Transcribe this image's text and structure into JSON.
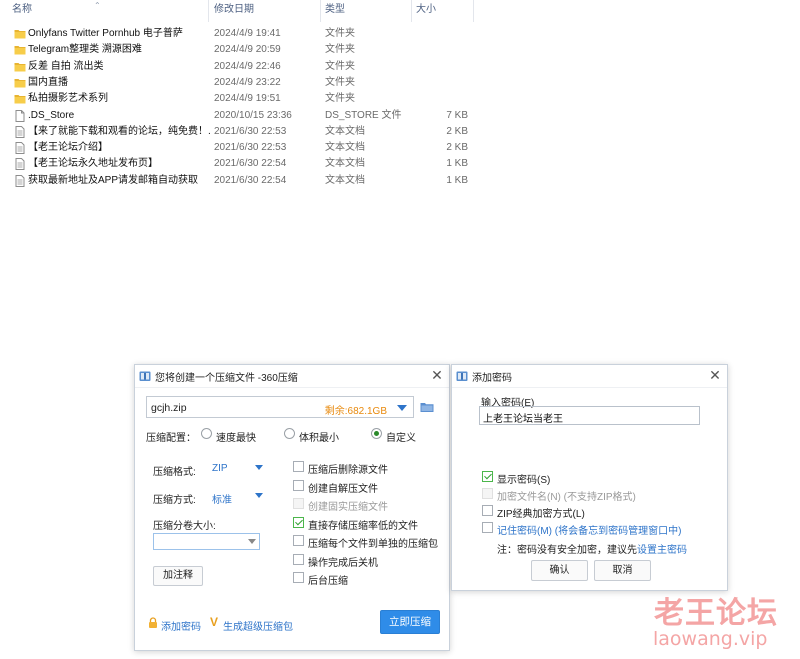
{
  "file_list": {
    "columns": {
      "name": "名称",
      "date": "修改日期",
      "type": "类型",
      "size": "大小"
    },
    "rows": [
      {
        "icon": "folder-icon",
        "name": "Onlyfans Twitter Pornhub 电子普萨",
        "date": "2024/4/9 19:41",
        "type": "文件夹",
        "size": ""
      },
      {
        "icon": "folder-icon",
        "name": "Telegram整理类 溯源困难",
        "date": "2024/4/9 20:59",
        "type": "文件夹",
        "size": ""
      },
      {
        "icon": "folder-icon",
        "name": "反差 自拍 流出类",
        "date": "2024/4/9 22:46",
        "type": "文件夹",
        "size": ""
      },
      {
        "icon": "folder-icon",
        "name": "国内直播",
        "date": "2024/4/9 23:22",
        "type": "文件夹",
        "size": ""
      },
      {
        "icon": "folder-icon",
        "name": "私拍摄影艺术系列",
        "date": "2024/4/9 19:51",
        "type": "文件夹",
        "size": ""
      },
      {
        "icon": "file-icon",
        "name": ".DS_Store",
        "date": "2020/10/15 23:36",
        "type": "DS_STORE 文件",
        "size": "7 KB"
      },
      {
        "icon": "text-file-icon",
        "name": "【来了就能下载和观看的论坛，纯免费！...",
        "date": "2021/6/30 22:53",
        "type": "文本文档",
        "size": "2 KB"
      },
      {
        "icon": "text-file-icon",
        "name": "【老王论坛介绍】",
        "date": "2021/6/30 22:53",
        "type": "文本文档",
        "size": "2 KB"
      },
      {
        "icon": "text-file-icon",
        "name": "【老王论坛永久地址发布页】",
        "date": "2021/6/30 22:54",
        "type": "文本文档",
        "size": "1 KB"
      },
      {
        "icon": "text-file-icon",
        "name": "获取最新地址及APP请发邮箱自动获取",
        "date": "2021/6/30 22:54",
        "type": "文本文档",
        "size": "1 KB"
      }
    ]
  },
  "compress_dialog": {
    "title": "您将创建一个压缩文件 -360压缩",
    "filename": "gcjh.zip",
    "free_space": "剩余:682.1GB",
    "config_label": "压缩配置：",
    "radio_fast": "速度最快",
    "radio_small": "体积最小",
    "radio_custom": "自定义",
    "format_label": "压缩格式:",
    "format_value": "ZIP",
    "method_label": "压缩方式:",
    "method_value": "标准",
    "split_label": "压缩分卷大小:",
    "split_value": "",
    "add_comment": "加注释",
    "options": [
      {
        "label": "压缩后删除源文件",
        "checked": false,
        "disabled": false
      },
      {
        "label": "创建自解压文件",
        "checked": false,
        "disabled": false
      },
      {
        "label": "创建固实压缩文件",
        "checked": false,
        "disabled": true
      },
      {
        "label": "直接存储压缩率低的文件",
        "checked": true,
        "disabled": false
      },
      {
        "label": "压缩每个文件到单独的压缩包",
        "checked": false,
        "disabled": false
      },
      {
        "label": "操作完成后关机",
        "checked": false,
        "disabled": false
      },
      {
        "label": "后台压缩",
        "checked": false,
        "disabled": false
      }
    ],
    "add_password": "添加密码",
    "super_pack": "生成超级压缩包",
    "compress_now": "立即压缩",
    "accent": "#2f8ce8",
    "orange": "#e8890c"
  },
  "password_dialog": {
    "title": "添加密码",
    "input_label": "输入密码(E)",
    "password_value": "上老王论坛当老王",
    "options": [
      {
        "label": "显示密码(S)",
        "checked": true,
        "disabled": false
      },
      {
        "label": "加密文件名(N) (不支持ZIP格式)",
        "checked": false,
        "disabled": true
      },
      {
        "label": "ZIP经典加密方式(L)",
        "checked": false,
        "disabled": false
      },
      {
        "label": "记住密码(M) (将会备忘到密码管理窗口中)",
        "checked": false,
        "disabled": false,
        "link": true
      }
    ],
    "note_prefix": "注：密码没有安全加密，建议先",
    "note_link": "设置主密码",
    "ok": "确认",
    "cancel": "取消"
  },
  "watermark": {
    "title": "老王论坛",
    "url": "laowang.vip",
    "color": "#f29a9a"
  }
}
